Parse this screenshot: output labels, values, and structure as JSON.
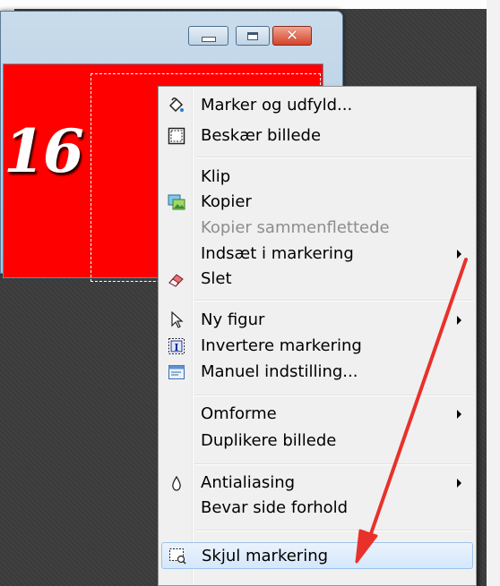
{
  "window": {
    "canvas_text": "16",
    "buttons": {
      "minimize": "minimize",
      "maximize": "maximize",
      "close": "close"
    }
  },
  "context_menu": {
    "items": [
      {
        "label": "Marker og udfyld...",
        "icon": "paint-bucket-icon",
        "submenu": false,
        "enabled": true
      },
      {
        "label": "Beskær billede",
        "icon": "crop-icon",
        "submenu": false,
        "enabled": true
      },
      {
        "label": "Klip",
        "icon": null,
        "submenu": false,
        "enabled": true
      },
      {
        "label": "Kopier",
        "icon": "copy-image-icon",
        "submenu": false,
        "enabled": true
      },
      {
        "label": "Kopier sammenflettede",
        "icon": null,
        "submenu": false,
        "enabled": false
      },
      {
        "label": "Indsæt i markering",
        "icon": null,
        "submenu": true,
        "enabled": true
      },
      {
        "label": "Slet",
        "icon": "eraser-icon",
        "submenu": false,
        "enabled": true
      },
      {
        "label": "Ny figur",
        "icon": "cursor-arrow-icon",
        "submenu": true,
        "enabled": true
      },
      {
        "label": "Invertere markering",
        "icon": "invert-selection-icon",
        "submenu": false,
        "enabled": true
      },
      {
        "label": "Manuel indstilling...",
        "icon": "manual-settings-icon",
        "submenu": false,
        "enabled": true
      },
      {
        "label": "Omforme",
        "icon": null,
        "submenu": true,
        "enabled": true
      },
      {
        "label": "Duplikere billede",
        "icon": null,
        "submenu": false,
        "enabled": true
      },
      {
        "label": "Antialiasing",
        "icon": "drop-icon",
        "submenu": true,
        "enabled": true
      },
      {
        "label": "Bevar side forhold",
        "icon": null,
        "submenu": false,
        "enabled": true
      },
      {
        "label": "Skjul markering",
        "icon": "hide-selection-icon",
        "submenu": false,
        "enabled": true,
        "highlighted": true
      }
    ]
  },
  "colors": {
    "canvas_red": "#ff0000",
    "menu_bg": "#f0f0f0",
    "highlight": "#d5e7fb",
    "annotation_arrow": "#e8312a"
  }
}
